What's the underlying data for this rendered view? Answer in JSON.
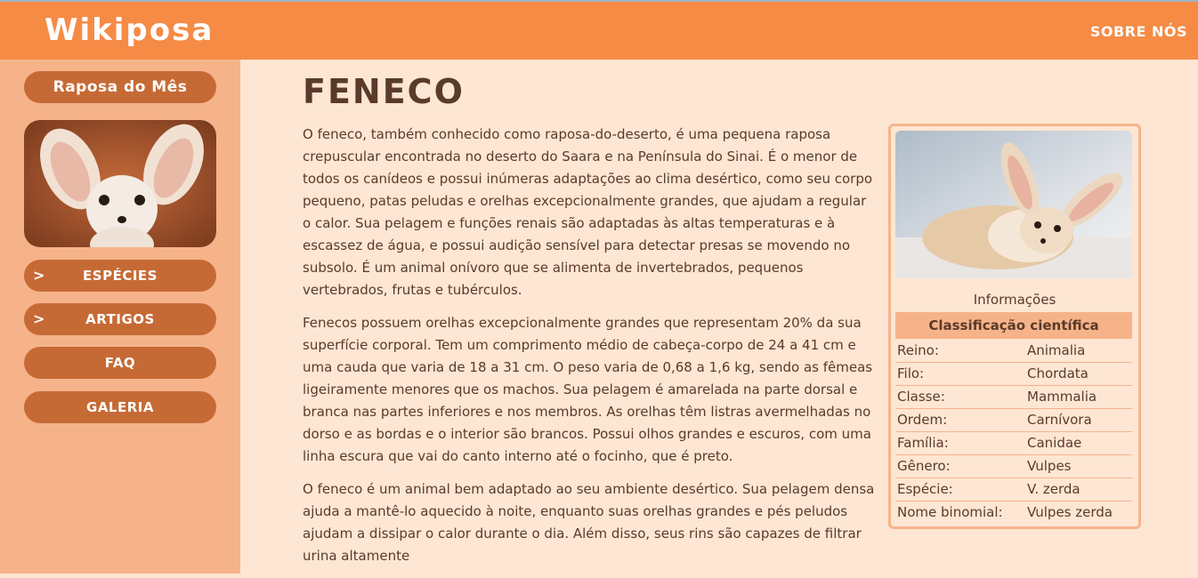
{
  "header": {
    "logo": "Wikiposa",
    "about": "SOBRE NÓS"
  },
  "sidebar": {
    "fox_of_month": "Raposa do Mês",
    "nav": [
      {
        "label": "ESPÉCIES",
        "has_chevron": true,
        "chevron": ">"
      },
      {
        "label": "ARTIGOS",
        "has_chevron": true,
        "chevron": ">"
      },
      {
        "label": "FAQ",
        "has_chevron": false
      },
      {
        "label": "GALERIA",
        "has_chevron": false
      }
    ]
  },
  "article": {
    "title": "FENECO",
    "paragraphs": [
      "O feneco, também conhecido como raposa-do-deserto, é uma pequena raposa crepuscular encontrada no deserto do Saara e na Península do Sinai. É o menor de todos os canídeos e possui inúmeras adaptações ao clima desértico, como seu corpo pequeno, patas peludas e orelhas excepcionalmente grandes, que ajudam a regular o calor. Sua pelagem e funções renais são adaptadas às altas temperaturas e à escassez de água, e possui audição sensível para detectar presas se movendo no subsolo. É um animal onívoro que se alimenta de invertebrados, pequenos vertebrados, frutas e tubérculos.",
      "Fenecos possuem orelhas excepcionalmente grandes que representam 20% da sua superfície corporal. Tem um comprimento médio de cabeça-corpo de 24 a 41 cm e uma cauda que varia de 18 a 31 cm. O peso varia de 0,68 a 1,6 kg, sendo as fêmeas ligeiramente menores que os machos. Sua pelagem é amarelada na parte dorsal e branca nas partes inferiores e nos membros. As orelhas têm listras avermelhadas no dorso e as bordas e o interior são brancos. Possui olhos grandes e escuros, com uma linha escura que vai do canto interno até o focinho, que é preto.",
      "O feneco é um animal bem adaptado ao seu ambiente desértico. Sua pelagem densa ajuda a mantê-lo aquecido à noite, enquanto suas orelhas grandes e pés peludos ajudam a dissipar o calor durante o dia. Além disso, seus rins são capazes de filtrar urina altamente"
    ]
  },
  "infobox": {
    "title": "Informações",
    "classification_heading": "Classificação científica",
    "rows": [
      {
        "key": "Reino:",
        "value": "Animalia"
      },
      {
        "key": "Filo:",
        "value": "Chordata"
      },
      {
        "key": "Classe:",
        "value": "Mammalia"
      },
      {
        "key": "Ordem:",
        "value": "Carnívora"
      },
      {
        "key": "Família:",
        "value": "Canidae"
      },
      {
        "key": "Gênero:",
        "value": "Vulpes"
      },
      {
        "key": "Espécie:",
        "value": "V. zerda"
      },
      {
        "key": "Nome binomial:",
        "value": "Vulpes zerda"
      }
    ]
  },
  "colors": {
    "header": "#f68b45",
    "sidebar": "#f6b38a",
    "button": "#c66a35",
    "background": "#fde6d3",
    "text": "#5a3a2a"
  }
}
